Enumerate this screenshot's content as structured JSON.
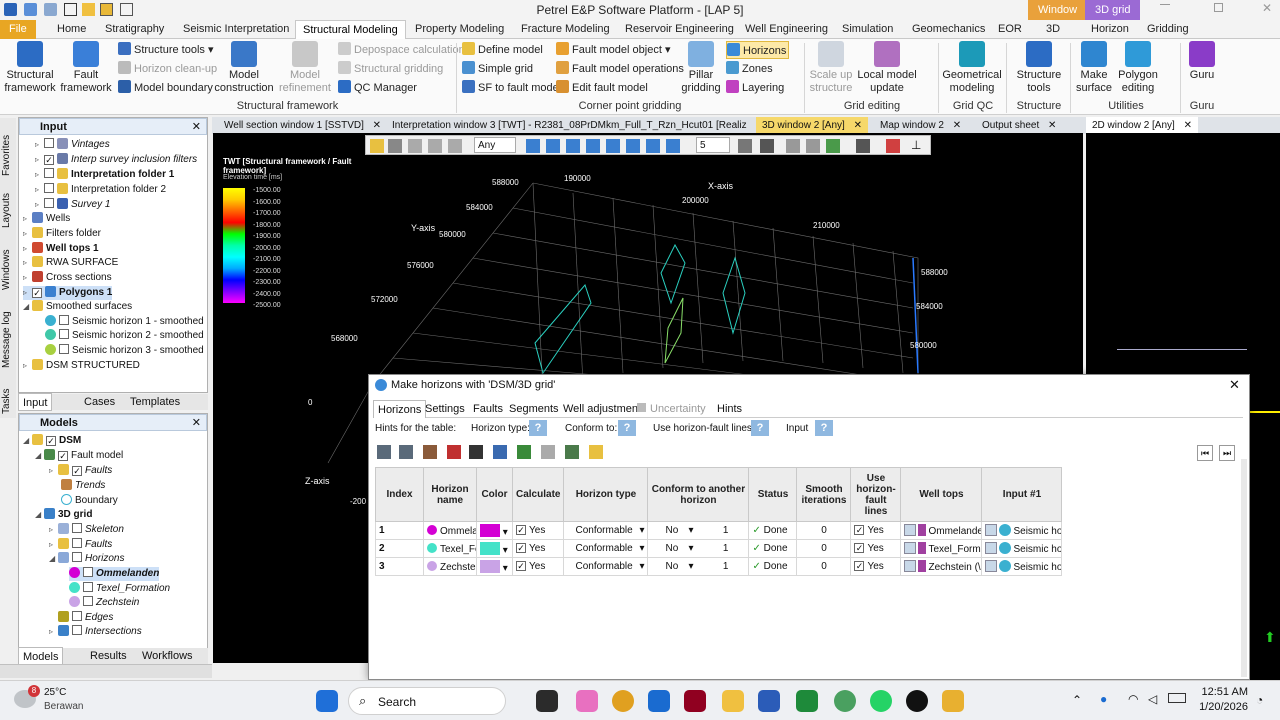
{
  "app": {
    "title": "Petrel E&P Software Platform - [LAP 5]",
    "ctx_tabs": [
      "Window",
      "3D grid"
    ]
  },
  "menubar": [
    "File",
    "Home",
    "Stratigraphy",
    "Seismic Interpretation",
    "Structural Modeling",
    "Property Modeling",
    "Fracture Modeling",
    "Reservoir Engineering",
    "Well Engineering",
    "Simulation",
    "Geomechanics",
    "EOR",
    "3D",
    "Horizon",
    "Gridding"
  ],
  "ribbon": {
    "structural_framework": "Structural framework",
    "fault_framework": "Fault framework",
    "structure_tools": "Structure tools",
    "horizon_cleanup": "Horizon clean-up",
    "model_boundary": "Model boundary",
    "model_construction": "Model construction",
    "model_refinement": "Model refinement",
    "group1": "Structural framework",
    "depospace": "Depospace calculation",
    "structural_gridding": "Structural gridding",
    "qc_manager": "QC Manager",
    "define_model": "Define model",
    "simple_grid": "Simple grid",
    "sf_to_fault": "SF to fault model",
    "fault_model_object": "Fault model object",
    "fault_model_ops": "Fault model operations",
    "edit_fault_model": "Edit fault model",
    "pillar_gridding": "Pillar gridding",
    "horizons": "Horizons",
    "zones": "Zones",
    "layering": "Layering",
    "group2": "Corner point gridding",
    "scale_up": "Scale up structure",
    "local_update": "Local model update",
    "group3": "Grid editing",
    "geo_modeling": "Geometrical modeling",
    "group4": "Grid QC",
    "structure_tools2": "Structure tools",
    "group5": "Structure",
    "make_surface": "Make surface",
    "polygon_editing": "Polygon editing",
    "group6": "Utilities",
    "guru": "Guru",
    "group7": "Guru"
  },
  "input_panel": {
    "title": "Input",
    "items": [
      "Vintages",
      "Interp survey inclusion filters",
      "Interpretation folder 1",
      "Interpretation folder 2",
      "Survey 1",
      "Wells",
      "Filters folder",
      "Well tops 1",
      "RWA SURFACE",
      "Cross sections",
      "Polygons 1",
      "Smoothed surfaces",
      "Seismic horizon 1 - smoothed",
      "Seismic horizon 2 - smoothed",
      "Seismic horizon 3 - smoothed",
      "DSM STRUCTURED"
    ],
    "tabs": [
      "Input",
      "Cases",
      "Templates"
    ]
  },
  "models_panel": {
    "title": "Models",
    "items": [
      "DSM",
      "Fault model",
      "Faults",
      "Trends",
      "Boundary",
      "3D grid",
      "Skeleton",
      "Faults",
      "Horizons",
      "Ommelanden",
      "Texel_Formation",
      "Zechstein",
      "Edges",
      "Intersections"
    ],
    "tabs": [
      "Models",
      "Results",
      "Workflows"
    ]
  },
  "side_tabs": [
    "Favorites",
    "Layouts",
    "Windows",
    "Message log",
    "Tasks"
  ],
  "doc_tabs": [
    "Well section window 1 [SSTVD]",
    "Interpretation window 3 [TWT] - R2381_08PrDMkm_Full_T_Rzn_Hcut01 [Realiz",
    "3D window 2 [Any]",
    "Map window 2",
    "Output sheet",
    "2D window 2 [Any]"
  ],
  "viewer": {
    "any": "Any",
    "num": "5",
    "legend_title": "TWT [Structural framework / Fault framework]",
    "legend_sub": "Elevation time [ms]",
    "legend_ticks": [
      "-1500.00",
      "-1600.00",
      "-1700.00",
      "-1800.00",
      "-1900.00",
      "-2000.00",
      "-2100.00",
      "-2200.00",
      "-2300.00",
      "-2400.00",
      "-2500.00"
    ],
    "xaxis": "X-axis",
    "yaxis": "Y-axis",
    "zaxis": "Z-axis",
    "labels": [
      "588000",
      "190000",
      "584000",
      "200000",
      "580000",
      "210000",
      "576000",
      "572000",
      "568000",
      "588000",
      "584000",
      "580000",
      "0",
      "-200"
    ]
  },
  "dialog": {
    "title": "Make horizons with 'DSM/3D grid'",
    "tabs": [
      "Horizons",
      "Settings",
      "Faults",
      "Segments",
      "Well adjustment",
      "Uncertainty",
      "Hints"
    ],
    "hints": {
      "label": "Hints for the table:",
      "horizon_type": "Horizon type:",
      "conform": "Conform to:",
      "hfl": "Use horizon-fault lines:",
      "input": "Input"
    },
    "columns": [
      "Index",
      "Horizon name",
      "Color",
      "Calculate",
      "Horizon type",
      "Conform to another horizon",
      "Status",
      "Smooth iterations",
      "Use horizon-fault lines",
      "Well tops",
      "Input #1"
    ],
    "rows": [
      {
        "index": "1",
        "name": "Ommelanden",
        "color": "#d400d4",
        "calc": "Yes",
        "type": "Conformable",
        "conform": "No",
        "n": "1",
        "status": "Done",
        "smooth": "0",
        "hfl": "Yes",
        "tops": "Ommelande",
        "input": "Seismic hor"
      },
      {
        "index": "2",
        "name": "Texel_Formation",
        "color": "#44e2c8",
        "calc": "Yes",
        "type": "Conformable",
        "conform": "No",
        "n": "1",
        "status": "Done",
        "smooth": "0",
        "hfl": "Yes",
        "tops": "Texel_Forma",
        "input": "Seismic hor"
      },
      {
        "index": "3",
        "name": "Zechstein",
        "color": "#c9a3e6",
        "calc": "Yes",
        "type": "Conformable",
        "conform": "No",
        "n": "1",
        "status": "Done",
        "smooth": "0",
        "hfl": "Yes",
        "tops": "Zechstein (\\",
        "input": "Seismic hor"
      }
    ]
  },
  "taskbar": {
    "temp": "25°C",
    "weather": "Berawan",
    "badge": "8",
    "search": "Search",
    "time": "12:51 AM",
    "date": "1/20/2026"
  }
}
